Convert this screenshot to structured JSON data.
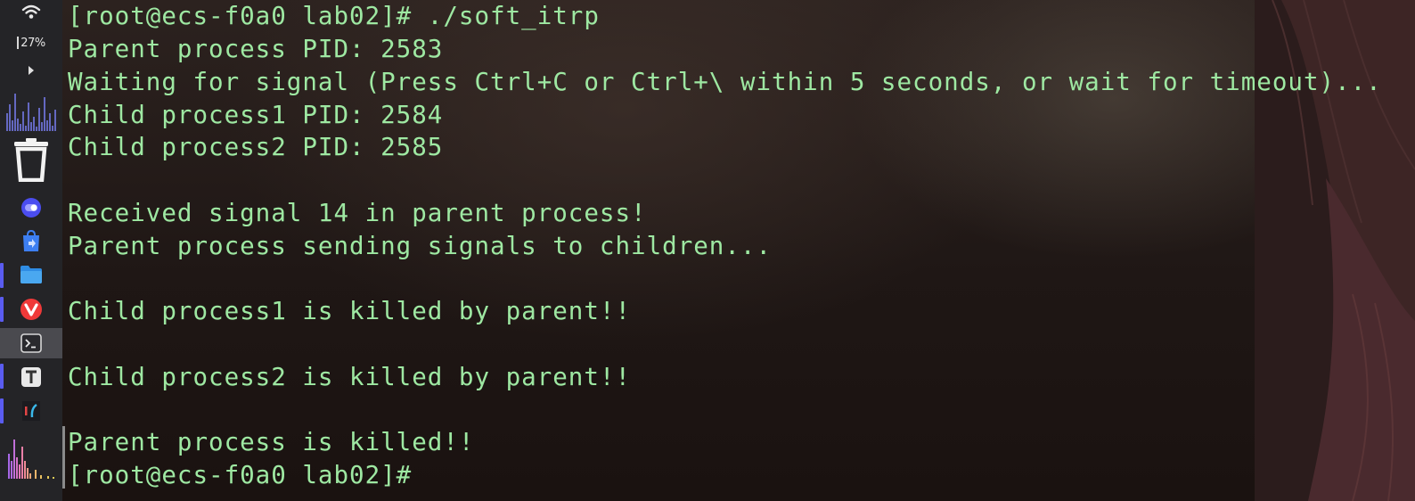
{
  "dock": {
    "battery_percent": "27%",
    "items": [
      {
        "name": "wifi-icon"
      },
      {
        "name": "battery-icon"
      },
      {
        "name": "expand-arrow-icon"
      },
      {
        "name": "cpu-graph-icon"
      },
      {
        "name": "trash-icon"
      },
      {
        "name": "toggle-app-icon"
      },
      {
        "name": "app-store-icon"
      },
      {
        "name": "files-icon"
      },
      {
        "name": "vivaldi-icon"
      },
      {
        "name": "terminal-icon"
      },
      {
        "name": "text-editor-icon"
      },
      {
        "name": "pycharm-icon"
      },
      {
        "name": "audio-visualizer-icon"
      }
    ]
  },
  "terminal": {
    "lines": [
      "[root@ecs-f0a0 lab02]# ./soft_itrp",
      "Parent process PID: 2583",
      "Waiting for signal (Press Ctrl+C or Ctrl+\\ within 5 seconds, or wait for timeout)...",
      "Child process1 PID: 2584",
      "Child process2 PID: 2585",
      "",
      "Received signal 14 in parent process!",
      "Parent process sending signals to children...",
      "",
      "Child process1 is killed by parent!!",
      "",
      "Child process2 is killed by parent!!",
      "",
      "Parent process is killed!!",
      "[root@ecs-f0a0 lab02]#"
    ],
    "text_color": "#9ee8a2"
  },
  "colors": {
    "dock_background": "#242427",
    "dock_indicator": "#5a5cf0",
    "wallpaper_dark": "#1c1513"
  }
}
